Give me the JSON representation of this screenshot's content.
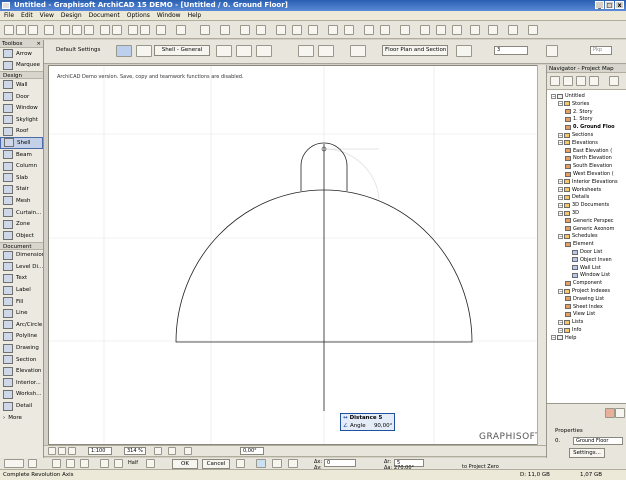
{
  "window": {
    "title": "Untitled - Graphisoft ArchiCAD 15 DEMO - [Untitled / 0. Ground Floor]",
    "min": "_",
    "max": "□",
    "close": "x"
  },
  "menu": [
    "File",
    "Edit",
    "View",
    "Design",
    "Document",
    "Options",
    "Window",
    "Help"
  ],
  "infobox": {
    "default_settings": "Default Settings",
    "shell_method": "Shell - General",
    "floor_plan_section": "Floor Plan and Section...",
    "value_field": "3",
    "right_value": "Pkp"
  },
  "toolbox": {
    "title": "Toolbox",
    "select": [
      "Arrow",
      "Marquee"
    ],
    "design_header": "Design",
    "design": [
      "Wall",
      "Door",
      "Window",
      "Skylight",
      "Roof",
      "Shell",
      "Beam",
      "Column",
      "Slab",
      "Stair",
      "Mesh",
      "Curtain...",
      "Zone",
      "Object"
    ],
    "document_header": "Document",
    "document": [
      "Dimension",
      "Level Di...",
      "Text",
      "Label",
      "Fill",
      "Line",
      "Arc/Circle",
      "Polyline",
      "Drawing",
      "Section",
      "Elevation",
      "Interior...",
      "Worksh...",
      "Detail"
    ],
    "more": "More",
    "selected": "Shell"
  },
  "canvas": {
    "notice": "ArchiCAD Demo version. Save, copy and teamwork functions are disabled.",
    "watermark": "GRAPHISOFT.",
    "tracker": {
      "distance_label": "Distance",
      "distance_value": "5",
      "angle_label": "Angle",
      "angle_value": "90,00°"
    }
  },
  "navigator": {
    "title": "Navigator - Project Map",
    "items": [
      {
        "label": "Untitled",
        "level": 0,
        "bold": false
      },
      {
        "label": "Stories",
        "level": 1,
        "bold": false
      },
      {
        "label": "2. Story",
        "level": 2,
        "bold": false
      },
      {
        "label": "1. Story",
        "level": 2,
        "bold": false
      },
      {
        "label": "0. Ground Floo",
        "level": 2,
        "bold": true
      },
      {
        "label": "Sections",
        "level": 1,
        "bold": false
      },
      {
        "label": "Elevations",
        "level": 1,
        "bold": false
      },
      {
        "label": "East Elevation (",
        "level": 2,
        "bold": false
      },
      {
        "label": "North Elevation",
        "level": 2,
        "bold": false
      },
      {
        "label": "South Elevation",
        "level": 2,
        "bold": false
      },
      {
        "label": "West Elevation (",
        "level": 2,
        "bold": false
      },
      {
        "label": "Interior Elevations",
        "level": 1,
        "bold": false
      },
      {
        "label": "Worksheets",
        "level": 1,
        "bold": false
      },
      {
        "label": "Details",
        "level": 1,
        "bold": false
      },
      {
        "label": "3D Documents",
        "level": 1,
        "bold": false
      },
      {
        "label": "3D",
        "level": 1,
        "bold": false
      },
      {
        "label": "Generic Perspec",
        "level": 2,
        "bold": false
      },
      {
        "label": "Generic Axonom",
        "level": 2,
        "bold": false
      },
      {
        "label": "Schedules",
        "level": 1,
        "bold": false
      },
      {
        "label": "Element",
        "level": 2,
        "bold": false
      },
      {
        "label": "Door List",
        "level": 3,
        "bold": false
      },
      {
        "label": "Object Inven",
        "level": 3,
        "bold": false
      },
      {
        "label": "Wall List",
        "level": 3,
        "bold": false
      },
      {
        "label": "Window List",
        "level": 3,
        "bold": false
      },
      {
        "label": "Component",
        "level": 2,
        "bold": false
      },
      {
        "label": "Project Indexes",
        "level": 1,
        "bold": false
      },
      {
        "label": "Drawing List",
        "level": 2,
        "bold": false
      },
      {
        "label": "Sheet Index",
        "level": 2,
        "bold": false
      },
      {
        "label": "View List",
        "level": 2,
        "bold": false
      },
      {
        "label": "Lists",
        "level": 1,
        "bold": false
      },
      {
        "label": "Info",
        "level": 1,
        "bold": false
      },
      {
        "label": "Help",
        "level": 0,
        "bold": false
      }
    ],
    "properties_label": "Properties",
    "property_number": "0.",
    "property_value": "Ground Floor",
    "settings_button": "Settings..."
  },
  "infobar": {
    "scale": "1:100",
    "zoom": "314 %",
    "angle": "0,00°"
  },
  "bottom": {
    "ok": "OK",
    "cancel": "Cancel",
    "half": "Half",
    "dx_label": "Δx:",
    "dx": "0",
    "dy_label": "Δy:",
    "dy": "0",
    "r_label": "Δr:",
    "r": "5",
    "a_label": "Δa:",
    "a": "270,00°",
    "ref": "to Project Zero"
  },
  "status": {
    "text": "Complete Revolution Axis",
    "disk": "D: 11,0 GB",
    "ram": "1,07 GB"
  }
}
